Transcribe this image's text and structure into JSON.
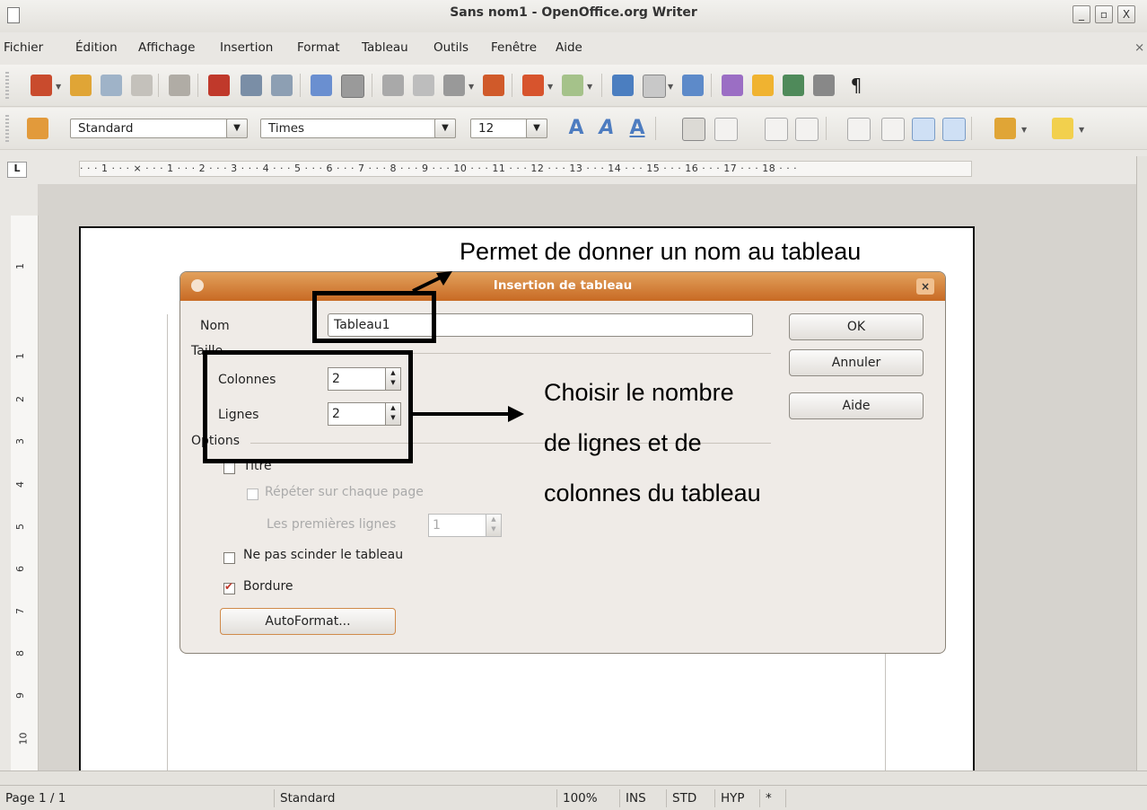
{
  "window": {
    "title": "Sans nom1 - OpenOffice.org Writer",
    "minimize": "_",
    "maximize": "▫",
    "close": "X"
  },
  "menu": [
    "Fichier",
    "Édition",
    "Affichage",
    "Insertion",
    "Format",
    "Tableau",
    "Outils",
    "Fenêtre",
    "Aide"
  ],
  "menu_close": "×",
  "format_toolbar": {
    "style": "Standard",
    "font": "Times",
    "size": "12"
  },
  "ruler": {
    "marks": "· · · 1 · · · ⨯ · · · 1 · · · 2 · · · 3 · · · 4 · · · 5 · · · 6 · · · 7 · · · 8 · · · 9 · · · 10 · · · 11 · · · 12 · · · 13 · · · 14 · · · 15 · · · 16 · · · 17 · · · 18 · · ·"
  },
  "vruler_numbers": [
    "1",
    "1",
    "2",
    "3",
    "4",
    "5",
    "6",
    "7",
    "8",
    "9",
    "10"
  ],
  "dialog": {
    "title": "Insertion de tableau",
    "name_label": "Nom",
    "name_value": "Tableau1",
    "size_section": "Taille",
    "columns_label": "Colonnes",
    "columns_value": "2",
    "rows_label": "Lignes",
    "rows_value": "2",
    "options_section": "Options",
    "title_option": "Titre",
    "repeat_option": "Répéter sur chaque page",
    "first_rows_label": "Les premières lignes",
    "first_rows_value": "1",
    "no_split_option": "Ne pas scinder le tableau",
    "border_option": "Bordure",
    "autoformat_button": "AutoFormat...",
    "ok_button": "OK",
    "cancel_button": "Annuler",
    "help_button": "Aide"
  },
  "annotations": {
    "name_note": "Permet de donner un nom au tableau",
    "choose_line1": "Choisir le nombre",
    "choose_line2": "de lignes et de",
    "choose_line3": "colonnes du tableau"
  },
  "status": {
    "page": "Page 1 / 1",
    "style": "Standard",
    "zoom": "100%",
    "ins": "INS",
    "std": "STD",
    "hyp": "HYP",
    "modified": "*"
  },
  "icons": [
    "new-document-icon",
    "open-icon",
    "save-icon",
    "email-icon",
    "edit-icon",
    "pdf-icon",
    "print-icon",
    "print-preview-icon",
    "spellcheck-icon",
    "autospellcheck-icon",
    "cut-icon",
    "copy-icon",
    "paste-icon",
    "format-paintbrush-icon",
    "undo-icon",
    "redo-icon",
    "hyperlink-icon",
    "table-icon",
    "draw-icon",
    "navigator-icon",
    "gallery-icon",
    "datasources-icon",
    "formatting-marks-icon",
    "styles-icon",
    "bold-icon",
    "italic-icon",
    "underline-icon",
    "align-left-icon",
    "align-center-icon",
    "align-right-icon",
    "justify-icon",
    "numbering-icon",
    "bullets-icon",
    "decrease-indent-icon",
    "increase-indent-icon",
    "highlight-icon",
    "font-color-icon"
  ]
}
